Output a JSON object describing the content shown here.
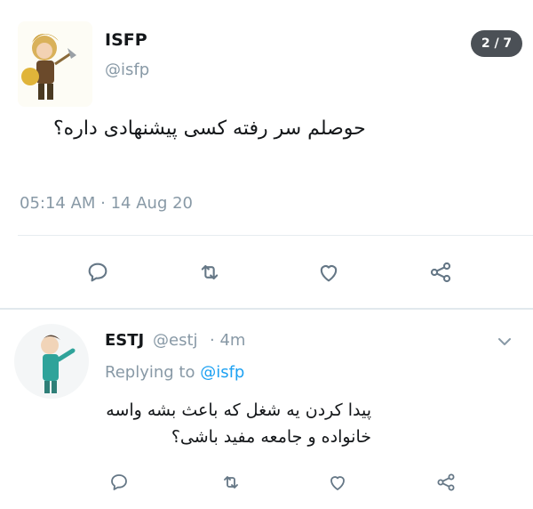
{
  "tweet": {
    "display_name": "ISFP",
    "handle": "@isfp",
    "badge": "2 / 7",
    "text": "حوصلم سر رفته کسی پیشنهادی داره؟",
    "timestamp": "05:14 AM · 14 Aug 20"
  },
  "reply": {
    "display_name": "ESTJ",
    "handle": "@estj",
    "time": "· 4m",
    "replying_to_label": "Replying to",
    "replying_to_handle": "@isfp",
    "text": "پیدا کردن یه شغل که باعث بشه واسه خانواده و جامعه مفید باشی؟"
  },
  "icons": {
    "reply": "comment-icon",
    "retweet": "retweet-icon",
    "like": "heart-icon",
    "share": "share-icon",
    "more": "chevron-down-icon"
  },
  "colors": {
    "text": "#14171a",
    "muted": "#8899a6",
    "link": "#1da1f2",
    "badge_bg": "#4b5056"
  }
}
